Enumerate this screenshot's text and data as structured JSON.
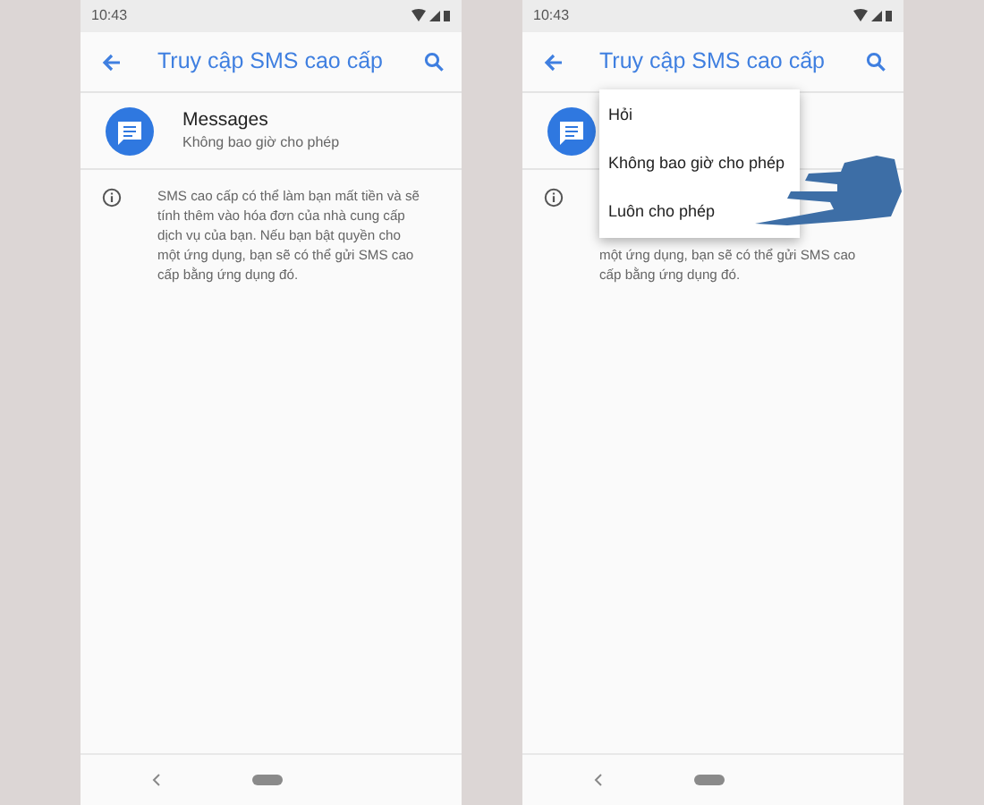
{
  "screens": [
    {
      "status_time": "10:43",
      "title": "Truy cập SMS cao cấp",
      "app": {
        "name": "Messages",
        "subtitle": "Không bao giờ cho phép"
      },
      "info_lines": [
        "SMS cao cấp có thể làm bạn mất tiền và sẽ",
        "tính thêm vào hóa đơn của nhà cung cấp",
        "dịch vụ của bạn. Nếu bạn bật quyền cho",
        "một ứng dụng, bạn sẽ có thể gửi SMS cao",
        "cấp bằng ứng dụng đó."
      ]
    },
    {
      "status_time": "10:43",
      "title": "Truy cập SMS cao cấp",
      "info_lines": [
        "một ứng dụng, bạn sẽ có thể gửi SMS cao",
        "cấp bằng ứng dụng đó."
      ],
      "menu": [
        {
          "label": "Hỏi"
        },
        {
          "label": "Không bao giờ cho phép"
        },
        {
          "label": "Luôn cho phép"
        }
      ]
    }
  ]
}
